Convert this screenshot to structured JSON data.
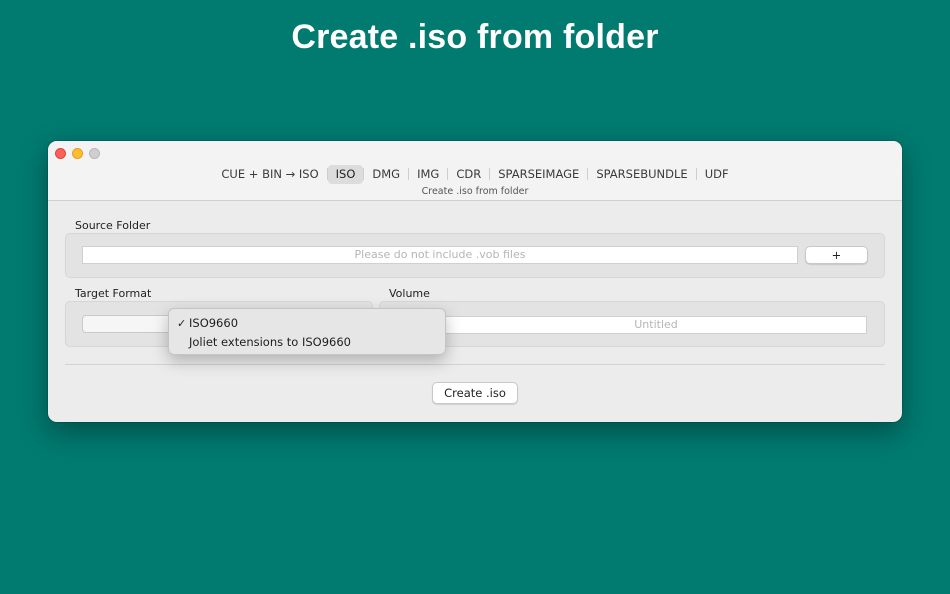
{
  "headline": "Create .iso from folder",
  "window": {
    "tabs": [
      {
        "label": "CUE + BIN → ISO",
        "active": false
      },
      {
        "label": "ISO",
        "active": true
      },
      {
        "label": "DMG",
        "active": false
      },
      {
        "label": "IMG",
        "active": false
      },
      {
        "label": "CDR",
        "active": false
      },
      {
        "label": "SPARSEIMAGE",
        "active": false
      },
      {
        "label": "SPARSEBUNDLE",
        "active": false
      },
      {
        "label": "UDF",
        "active": false
      }
    ],
    "subtitle": "Create .iso from folder"
  },
  "source": {
    "label": "Source Folder",
    "placeholder": "Please do not include .vob files",
    "add_button": "+"
  },
  "target": {
    "label": "Target Format",
    "menu_items": [
      {
        "label": "ISO9660",
        "checked": true
      },
      {
        "label": "Joliet extensions to ISO9660",
        "checked": false
      }
    ],
    "check_glyph": "✓"
  },
  "volume": {
    "label": "Volume",
    "placeholder": "Untitled"
  },
  "create_button": "Create .iso",
  "colors": {
    "background": "#017a70",
    "close": "#fe5f57",
    "minimize": "#febc2e",
    "zoom": "#cfcfcf"
  }
}
